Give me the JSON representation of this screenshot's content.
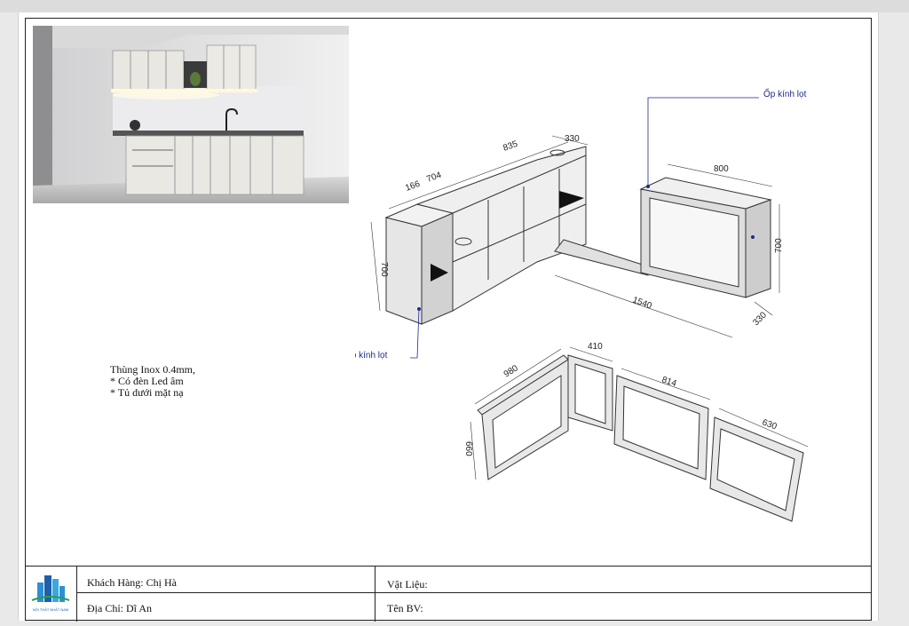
{
  "notes": {
    "line1": "Thùng Inox 0.4mm,",
    "line2": "* Có đèn Led âm",
    "line3": "* Tủ dưới mặt nạ"
  },
  "callouts": {
    "glass_top": "Ốp kính lọt",
    "glass_left": "Ốp kính lọt"
  },
  "dimensions": {
    "d166": "166",
    "d704": "704",
    "d835": "835",
    "d330_top": "330",
    "d800": "800",
    "d700_left": "700",
    "d700_right": "700",
    "d1540": "1540",
    "d330_bottom": "330",
    "d410": "410",
    "d980": "980",
    "d814": "814",
    "d630": "630",
    "d660": "660"
  },
  "titleblock": {
    "customer": "Khách Hàng: Chị Hà",
    "address": "Địa Chỉ: Dĩ An",
    "material": "Vật Liệu:",
    "drawing_name": "Tên BV:",
    "logo_text": "NỘI THẤT NHẤT NAM"
  },
  "colors": {
    "callout": "#1d2a8a",
    "panel": "#e4e4e4",
    "panel_dark": "#b9b9b9"
  }
}
